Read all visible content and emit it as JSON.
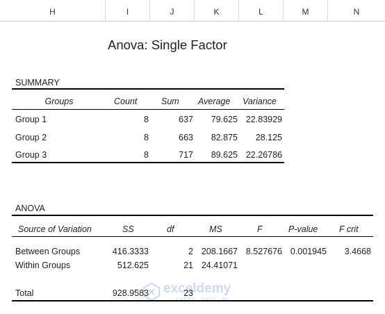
{
  "columns": [
    "H",
    "I",
    "J",
    "K",
    "L",
    "M",
    "N"
  ],
  "title": "Anova: Single Factor",
  "summary": {
    "label": "SUMMARY",
    "headers": [
      "Groups",
      "Count",
      "Sum",
      "Average",
      "Variance"
    ],
    "rows": [
      [
        "Group 1",
        "8",
        "637",
        "79.625",
        "22.83929"
      ],
      [
        "Group 2",
        "8",
        "663",
        "82.875",
        "28.125"
      ],
      [
        "Group 3",
        "8",
        "717",
        "89.625",
        "22.26786"
      ]
    ]
  },
  "anova": {
    "label": "ANOVA",
    "headers": [
      "Source of Variation",
      "SS",
      "df",
      "MS",
      "F",
      "P-value",
      "F crit"
    ],
    "rows": [
      [
        "Between Groups",
        "416.3333",
        "2",
        "208.1667",
        "8.527676",
        "0.001945",
        "3.4668"
      ],
      [
        "Within Groups",
        "512.625",
        "21",
        "24.41071",
        "",
        "",
        ""
      ]
    ],
    "total": [
      "Total",
      "928.9583",
      "23"
    ]
  },
  "watermark": {
    "name": "exceldemy",
    "tagline": "EXCEL · DATA · BI",
    "color": "#5b7fbf"
  }
}
